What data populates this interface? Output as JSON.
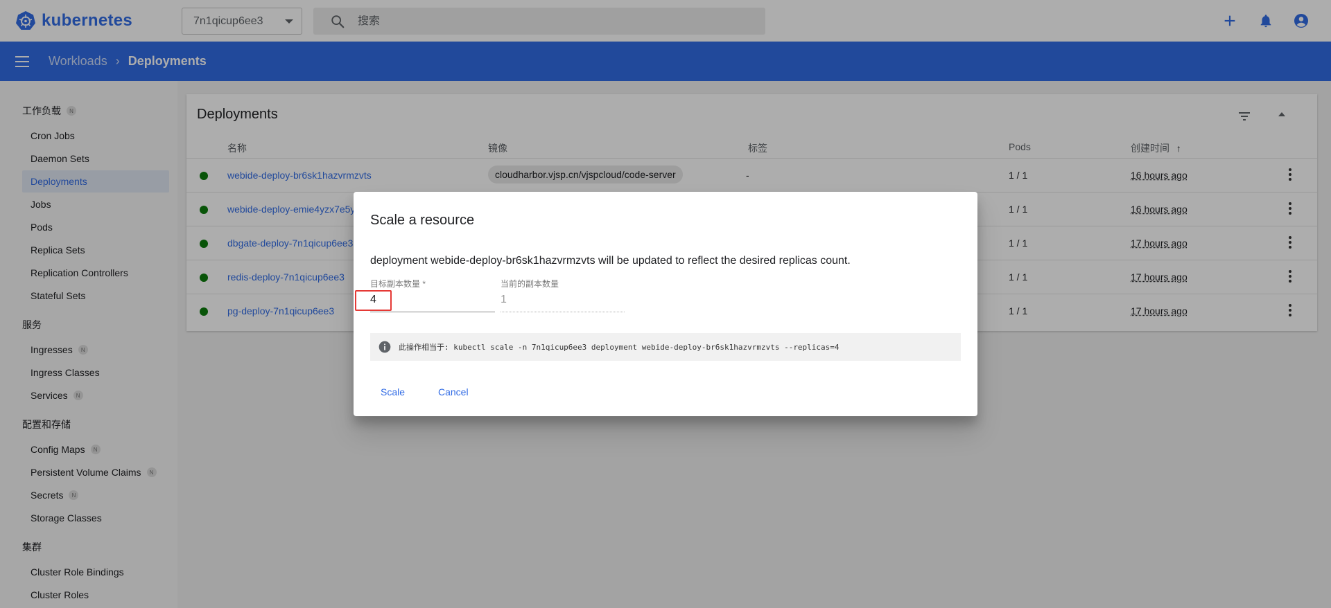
{
  "app": {
    "name": "kubernetes",
    "namespace": "7n1qicup6ee3",
    "search_placeholder": "搜索"
  },
  "breadcrumb": {
    "parent": "Workloads",
    "current": "Deployments"
  },
  "sidebar": {
    "groups": [
      {
        "title": "工作负载",
        "badge": "N",
        "items": [
          {
            "label": "Cron Jobs"
          },
          {
            "label": "Daemon Sets"
          },
          {
            "label": "Deployments",
            "active": true
          },
          {
            "label": "Jobs"
          },
          {
            "label": "Pods"
          },
          {
            "label": "Replica Sets"
          },
          {
            "label": "Replication Controllers"
          },
          {
            "label": "Stateful Sets"
          }
        ]
      },
      {
        "title": "服务",
        "items": [
          {
            "label": "Ingresses",
            "badge": "N"
          },
          {
            "label": "Ingress Classes"
          },
          {
            "label": "Services",
            "badge": "N"
          }
        ]
      },
      {
        "title": "配置和存储",
        "items": [
          {
            "label": "Config Maps",
            "badge": "N"
          },
          {
            "label": "Persistent Volume Claims",
            "badge": "N"
          },
          {
            "label": "Secrets",
            "badge": "N"
          },
          {
            "label": "Storage Classes"
          }
        ]
      },
      {
        "title": "集群",
        "items": [
          {
            "label": "Cluster Role Bindings"
          },
          {
            "label": "Cluster Roles"
          }
        ]
      }
    ]
  },
  "card": {
    "title": "Deployments",
    "columns": [
      "名称",
      "镜像",
      "标签",
      "Pods",
      "创建时间"
    ],
    "sort_indicator": "↑",
    "rows": [
      {
        "name": "webide-deploy-br6sk1hazvrmzvts",
        "image": "cloudharbor.vjsp.cn/vjspcloud/code-server",
        "labels": "-",
        "pods": "1 / 1",
        "age": "16 hours ago"
      },
      {
        "name": "webide-deploy-emie4yzx7e5y",
        "image": "",
        "labels": "",
        "pods": "1 / 1",
        "age": "16 hours ago"
      },
      {
        "name": "dbgate-deploy-7n1qicup6ee3",
        "image": "",
        "labels": "",
        "pods": "1 / 1",
        "age": "17 hours ago"
      },
      {
        "name": "redis-deploy-7n1qicup6ee3",
        "image": "",
        "labels": "",
        "pods": "1 / 1",
        "age": "17 hours ago"
      },
      {
        "name": "pg-deploy-7n1qicup6ee3",
        "image": "",
        "labels": "",
        "pods": "1 / 1",
        "age": "17 hours ago"
      }
    ]
  },
  "dialog": {
    "title": "Scale a resource",
    "description": "deployment webide-deploy-br6sk1hazvrmzvts will be updated to reflect the desired replicas count.",
    "target_label": "目标副本数量 *",
    "target_value": "4",
    "current_label": "当前的副本数量",
    "current_value": "1",
    "info": "此操作相当于: kubectl scale -n 7n1qicup6ee3 deployment webide-deploy-br6sk1hazvrmzvts --replicas=4",
    "scale_label": "Scale",
    "cancel_label": "Cancel"
  },
  "colors": {
    "brand": "#326ce5",
    "status_ok": "#0d7d0d",
    "highlight": "#e53935"
  }
}
